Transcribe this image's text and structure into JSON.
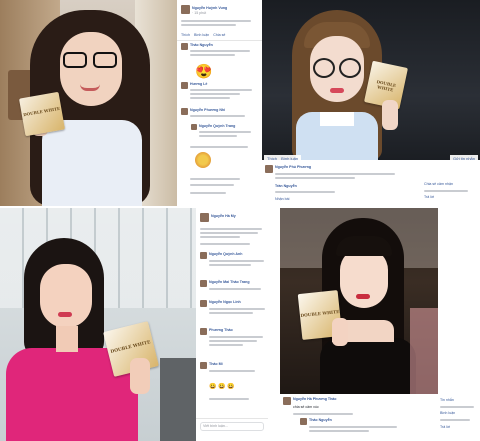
{
  "panel1": {
    "post_author": "Nguyễn Huỳnh Vung",
    "actions": [
      "Thích",
      "Bình luận",
      "Chia sẻ"
    ],
    "comment_author": "Thảo Nguyễn",
    "liker_1": "Hương Lê",
    "liker_2": "Nguyễn Phương Nhi",
    "reply_author": "Nguyễn Quỳnh Trang",
    "emoji": "😍"
  },
  "panel2": {
    "left_btns": [
      "Thích",
      "Bình luận"
    ],
    "right_btn": "Gửi tin nhắn",
    "post_author": "Nguyễn Phú Phương",
    "comment_author": "Trần Nguyễn",
    "reply_label": "Nhận bài",
    "side_1": "Chia sẻ cảm nhận",
    "side_2": "Trả lời"
  },
  "panel3": {
    "post_author": "Nguyễn Hà My",
    "name_1": "Nguyễn Quỳnh Anh",
    "name_2": "Nguyễn Mai Thảo Trang",
    "name_3": "Nguyễn Ngọc Linh",
    "name_4": "Phương Thảo",
    "name_5": "Thảo Mi",
    "emoji": "😀 😀 😀",
    "input_placeholder": "Viết bình luận..."
  },
  "panel4": {
    "post_author": "Nguyễn Hà Phương Thảo",
    "comment": "chia sẻ cảm xúc",
    "reply_author": "Thảo Nguyễn",
    "side_1": "Tin nhắn",
    "side_2": "Bình luận",
    "side_3": "Trả lời"
  },
  "colors": {
    "fb_link": "#365899",
    "meta": "#90949c",
    "product_gold": "#d8b46a",
    "pink_top": "#e0267a"
  },
  "product_text": "DOUBLE WHITE"
}
